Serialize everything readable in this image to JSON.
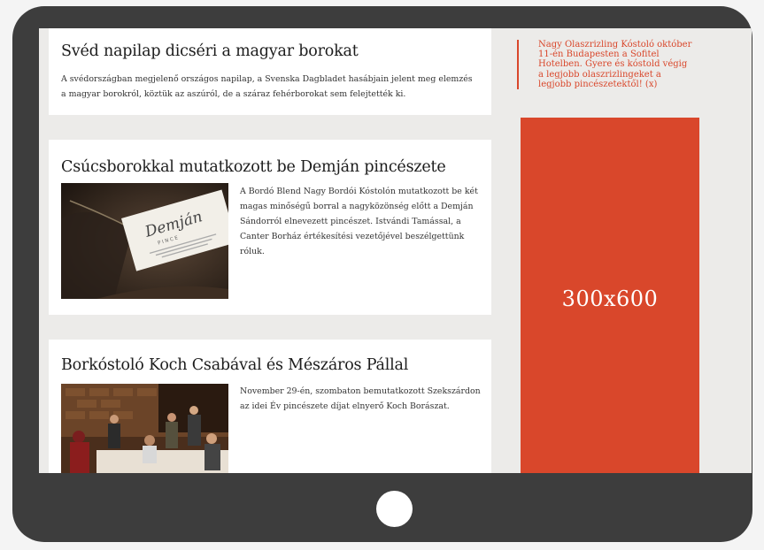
{
  "articles": [
    {
      "title": "Svéd napilap dicséri a magyar borokat",
      "excerpt": "A svédországban megjelenő országos napilap, a Svenska Dagbladet hasábjain jelent meg elemzés a magyar borokról, köztük az aszúról, de a száraz fehérborokat sem felejtették ki."
    },
    {
      "title": "Csúcsborokkal mutatkozott be Demján pincészete",
      "excerpt": "A Bordó Blend Nagy Bordói Kóstolón mutatkozott be két magas minőségű borral a nagyközönség előtt a Demján Sándorról elnevezett pincészet. Istvándi Tamással, a Canter Borház értékesítési vezetőjével beszélgettünk róluk.",
      "image": {
        "script_text": "Demján",
        "subtext": "P I N C E"
      }
    },
    {
      "title": "Borkóstoló Koch Csabával és Mészáros Pállal",
      "excerpt": "November 29-én, szombaton bemutatkozott Szekszárdon az idei Év pincészete díjat elnyerő Koch Borászat."
    }
  ],
  "sidebar": {
    "promo_text": "Nagy Olaszrizling Kóstoló október 11-én Budapesten a Sofitel Hotelben. Gyere és kóstold végig a legjobb olaszrizlingeket a legjobb pincészetektől! (x)",
    "ad_label": "300x600"
  },
  "colors": {
    "accent": "#d9472b",
    "device_frame": "#3d3d3d",
    "screen_bg": "#ecebe9"
  }
}
